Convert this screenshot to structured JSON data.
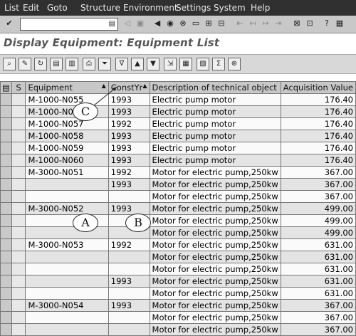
{
  "menu": [
    "List",
    "Edit",
    "Goto",
    "Structure",
    "Environment",
    "Settings",
    "System",
    "Help"
  ],
  "title": "Display Equipment: Equipment List",
  "table": {
    "headers": {
      "s": "S",
      "equipment": "Equipment",
      "constyr": "ConstYr",
      "description": "Description of technical object",
      "value": "Acquisition Value"
    },
    "rows": [
      {
        "equipment": "M-1000-N055",
        "constyr": "1993",
        "description": "Electric pump motor",
        "value": "176.40"
      },
      {
        "equipment": "M-1000-N056",
        "constyr": "1993",
        "description": "Electric pump motor",
        "value": "176.40"
      },
      {
        "equipment": "M-1000-N057",
        "constyr": "1992",
        "description": "Electric pump motor",
        "value": "176.40"
      },
      {
        "equipment": "M-1000-N058",
        "constyr": "1993",
        "description": "Electric pump motor",
        "value": "176.40"
      },
      {
        "equipment": "M-1000-N059",
        "constyr": "1993",
        "description": "Electric pump motor",
        "value": "176.40"
      },
      {
        "equipment": "M-1000-N060",
        "constyr": "1993",
        "description": "Electric pump motor",
        "value": "176.40"
      },
      {
        "equipment": "M-3000-N051",
        "constyr": "1992",
        "description": "Motor for electric pump,250kw",
        "value": "367.00"
      },
      {
        "equipment": "",
        "constyr": "1993",
        "description": "Motor for electric pump,250kw",
        "value": "367.00"
      },
      {
        "equipment": "",
        "constyr": "",
        "description": "Motor for electric pump,250kw",
        "value": "367.00"
      },
      {
        "equipment": "M-3000-N052",
        "constyr": "1993",
        "description": "Motor for electric pump,250kw",
        "value": "499.00"
      },
      {
        "equipment": "",
        "constyr": "",
        "description": "Motor for electric pump,250kw",
        "value": "499.00"
      },
      {
        "equipment": "",
        "constyr": "",
        "description": "Motor for electric pump,250kw",
        "value": "499.00"
      },
      {
        "equipment": "M-3000-N053",
        "constyr": "1992",
        "description": "Motor for electric pump,250kw",
        "value": "631.00"
      },
      {
        "equipment": "",
        "constyr": "",
        "description": "Motor for electric pump,250kw",
        "value": "631.00"
      },
      {
        "equipment": "",
        "constyr": "",
        "description": "Motor for electric pump,250kw",
        "value": "631.00"
      },
      {
        "equipment": "",
        "constyr": "1993",
        "description": "Motor for electric pump,250kw",
        "value": "631.00"
      },
      {
        "equipment": "",
        "constyr": "",
        "description": "Motor for electric pump,250kw",
        "value": "631.00"
      },
      {
        "equipment": "M-3000-N054",
        "constyr": "1993",
        "description": "Motor for electric pump,250kw",
        "value": "367.00"
      },
      {
        "equipment": "",
        "constyr": "",
        "description": "Motor for electric pump,250kw",
        "value": "367.00"
      },
      {
        "equipment": "",
        "constyr": "",
        "description": "Motor for electric pump,250kw",
        "value": "367.00"
      }
    ]
  },
  "callouts": {
    "a": "A",
    "b": "B",
    "c": "C"
  }
}
